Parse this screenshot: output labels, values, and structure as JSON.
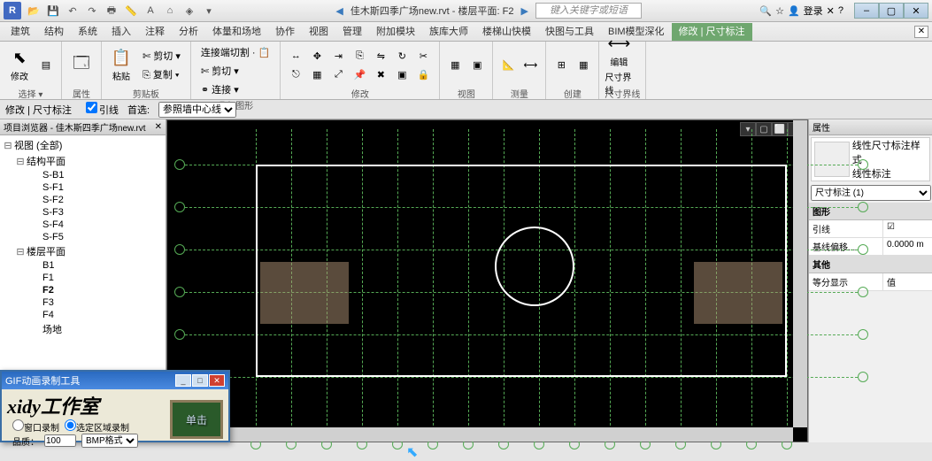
{
  "title": {
    "document": "佳木斯四季广场new.rvt - 楼层平面: F2",
    "search_placeholder": "键入关键字或短语",
    "login": "登录"
  },
  "menus": [
    "建筑",
    "结构",
    "系统",
    "插入",
    "注释",
    "分析",
    "体量和场地",
    "协作",
    "视图",
    "管理",
    "附加模块",
    "族库大师",
    "楼梯山快模",
    "快图与工具",
    "BIM模型深化",
    "修改 | 尺寸标注"
  ],
  "active_menu": 15,
  "ribbon": {
    "g1": "选择 ▾",
    "g2_lbl": "属性",
    "g3_paste": "粘贴",
    "g3_cut": "✄ 剪切 ▾",
    "g3_copy": "⎘ 复制 ▾",
    "g3_join1": "连接端切割 · 📋",
    "g3_join2": "✄ 剪切 ▾",
    "g3_join3": "⚭ 连接 ▾",
    "g3_lbl": "剪贴板",
    "g4_lbl": "几何图形",
    "g5_lbl": "修改",
    "g6_lbl": "视图",
    "g7_lbl": "测量",
    "g8_lbl": "创建",
    "g9_1": "编辑",
    "g9_2": "尺寸界线",
    "g9_lbl": "尺寸界线"
  },
  "optbar": {
    "label": "修改 | 尺寸标注",
    "chk": "引线",
    "pref": "首选:",
    "opt": "参照墙中心线"
  },
  "browser": {
    "title": "项目浏览器 - 佳木斯四季广场new.rvt",
    "root": "视图 (全部)",
    "cat1": "结构平面",
    "items1": [
      "S-B1",
      "S-F1",
      "S-F2",
      "S-F3",
      "S-F4",
      "S-F5"
    ],
    "cat2": "楼层平面",
    "items2": [
      "B1",
      "F1",
      "F2",
      "F3",
      "F4",
      "场地"
    ],
    "active": "F2"
  },
  "props": {
    "title": "属性",
    "type1": "线性尺寸标注样式",
    "type2": "线性标注",
    "selector": "尺寸标注 (1)",
    "sect1": "图形",
    "r1k": "引线",
    "r1v": "☑",
    "r2k": "基线偏移...",
    "r2v": "0.0000 m",
    "sect2": "其他",
    "r3k": "等分显示",
    "r3v": "值"
  },
  "gif": {
    "title": "GIF动画录制工具",
    "brand": "xidy工作室",
    "opt1": "窗口录制",
    "opt2": "选定区域录制",
    "quality": "品质：",
    "qval": "100",
    "fmt": "BMP格式",
    "btn": "单击"
  }
}
